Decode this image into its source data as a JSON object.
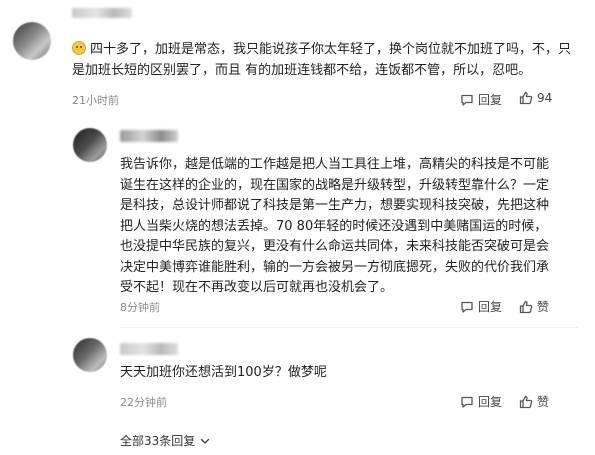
{
  "comments": [
    {
      "text": "四十多了，加班是常态，我只能说孩子你太年轻了，换个岗位就不加班了吗，不，只是加班长短的区别罢了，而且 有的加班连钱都不给，连饭都不管，所以，忍吧。",
      "time": "21小时前",
      "reply_label": "回复",
      "like_count": "94"
    },
    {
      "text": "我告诉你，越是低端的工作越是把人当工具往上堆，高精尖的科技是不可能诞生在这样的企业的，现在国家的战略是升级转型，升级转型靠什么？一定是科技，总设计师都说了科技是第一生产力，想要实现科技突破，先把这种把人当柴火烧的想法丢掉。70 80年轻的时候还没遇到中美赌国运的时候，也没提中华民族的复兴，更没有什么命运共同体，未来科技能否突破可是会决定中美博弈谁能胜利，输的一方会被另一方彻底摁死，失败的代价我们承受不起！现在不再改变以后可就再也没机会了。",
      "time": "8分钟前",
      "reply_label": "回复",
      "like_label": "赞"
    },
    {
      "text": "天天加班你还想活到100岁？做梦呢",
      "time": "22分钟前",
      "reply_label": "回复",
      "like_label": "赞"
    }
  ],
  "all_replies_label": "全部33条回复",
  "icons": [
    "reply-icon",
    "thumbs-up-icon",
    "chevron-down-icon",
    "emoji-icon"
  ]
}
